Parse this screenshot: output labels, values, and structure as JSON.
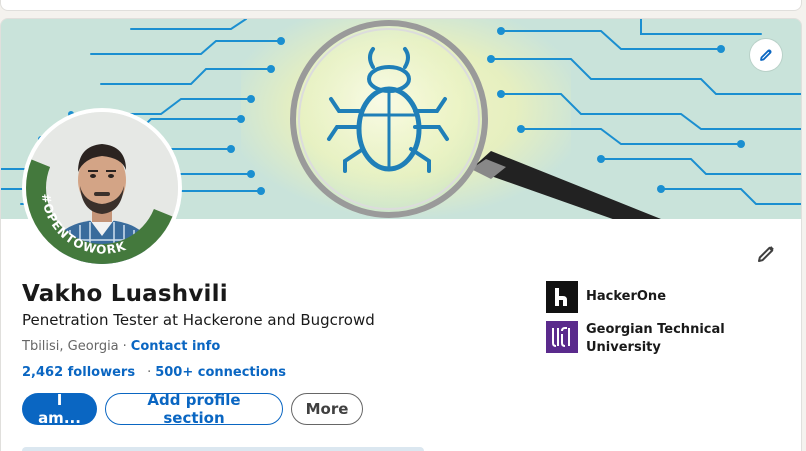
{
  "profile": {
    "name": "Vakho Luashvili",
    "headline": "Penetration Tester at Hackerone and Bugcrowd",
    "location": "Tbilisi, Georgia",
    "contact_info": "Contact info",
    "followers": "2,462 followers",
    "connections": "500+ connections",
    "open_to_work_badge": "#OPENTOWORK"
  },
  "actions": {
    "primary": "I am...",
    "add_section": "Add profile section",
    "more": "More"
  },
  "organizations": [
    {
      "name": "HackerOne",
      "icon": "hackerone-logo"
    },
    {
      "name": "Georgian Technical University",
      "icon": "gtu-logo"
    }
  ],
  "colors": {
    "accent": "#0a66c2",
    "open_to_work_ring": "#44793d",
    "banner_bg": "#c9e3da",
    "bug": "#1f7fb8"
  },
  "icons": {
    "cover_edit": "pencil-icon",
    "intro_edit": "pencil-icon",
    "banner_motif": "bug-magnifier"
  }
}
